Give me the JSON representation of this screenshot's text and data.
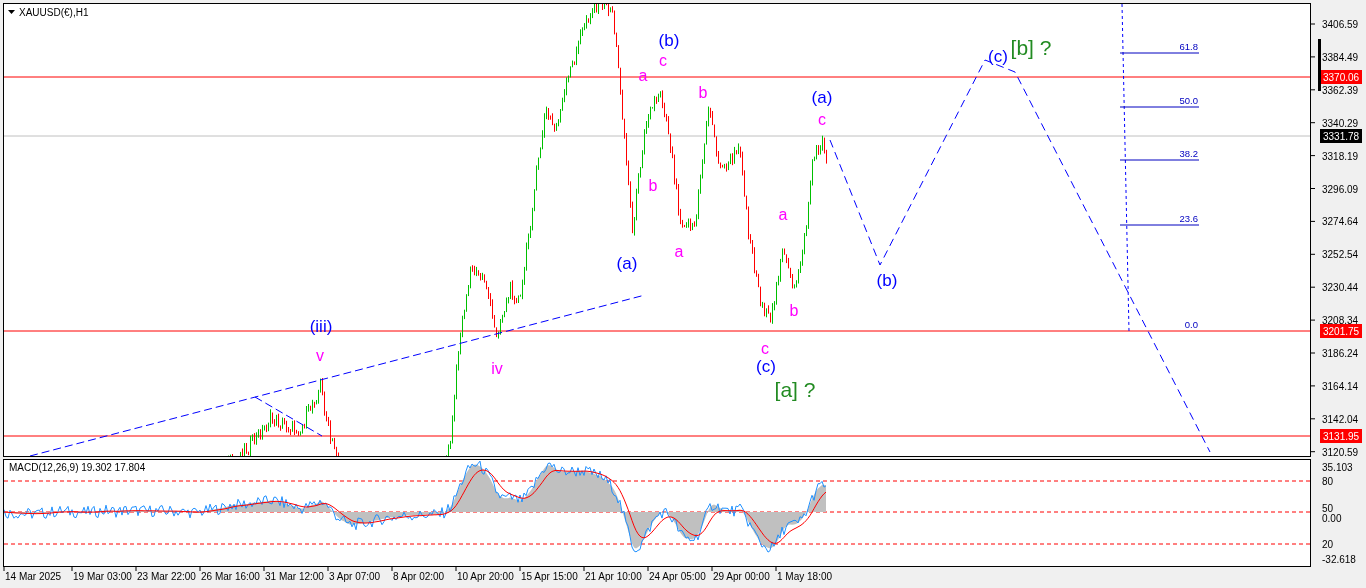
{
  "chart": {
    "symbol": "XAUUSD(€),H1"
  },
  "price_axis": {
    "ticks": [
      "3406.59",
      "3384.49",
      "3362.39",
      "3340.29",
      "3318.19",
      "3296.09",
      "3274.64",
      "3252.54",
      "3230.44",
      "3208.34",
      "3186.24",
      "3164.14",
      "3142.04",
      "3120.59"
    ]
  },
  "price_tags": [
    {
      "label": "3370.06",
      "kind": "level"
    },
    {
      "label": "3331.78",
      "kind": "bid"
    },
    {
      "label": "3201.75",
      "kind": "level"
    },
    {
      "label": "3131.95",
      "kind": "level"
    }
  ],
  "fibonacci_levels": [
    "61.8",
    "50.0",
    "38.2",
    "23.6",
    "0.0"
  ],
  "wave_labels": [
    {
      "text": "(b)",
      "color": "#0000ff"
    },
    {
      "text": "c",
      "color": "#ff00ff"
    },
    {
      "text": "a",
      "color": "#ff00ff"
    },
    {
      "text": "b",
      "color": "#ff00ff"
    },
    {
      "text": "(a)",
      "color": "#0000ff"
    },
    {
      "text": "c",
      "color": "#ff00ff"
    },
    {
      "text": "b",
      "color": "#ff00ff"
    },
    {
      "text": "(a)",
      "color": "#0000ff"
    },
    {
      "text": "a",
      "color": "#ff00ff"
    },
    {
      "text": "a",
      "color": "#ff00ff"
    },
    {
      "text": "(b)",
      "color": "#0000ff"
    },
    {
      "text": "b",
      "color": "#ff00ff"
    },
    {
      "text": "c",
      "color": "#ff00ff"
    },
    {
      "text": "(c)",
      "color": "#0000ff"
    },
    {
      "text": "[a] ?",
      "color": "#228b22"
    },
    {
      "text": "(iii)",
      "color": "#0000ff"
    },
    {
      "text": "v",
      "color": "#ff00ff"
    },
    {
      "text": "iv",
      "color": "#ff00ff"
    },
    {
      "text": "(c)",
      "color": "#0000ff"
    },
    {
      "text": "[b] ?",
      "color": "#228b22"
    }
  ],
  "macd": {
    "label": "MACD(12,26,9) 19.302 17.804",
    "axis": [
      "35.103",
      "80",
      "50",
      "0.00",
      "20",
      "-32.618"
    ]
  },
  "time_axis": [
    "14 Mar 2025",
    "19 Mar 03:00",
    "23 Mar 22:00",
    "26 Mar 16:00",
    "31 Mar 12:00",
    "3 Apr 07:00",
    "8 Apr 02:00",
    "10 Apr 20:00",
    "15 Apr 15:00",
    "21 Apr 10:00",
    "24 Apr 05:00",
    "29 Apr 00:00",
    "1 May 18:00"
  ]
}
